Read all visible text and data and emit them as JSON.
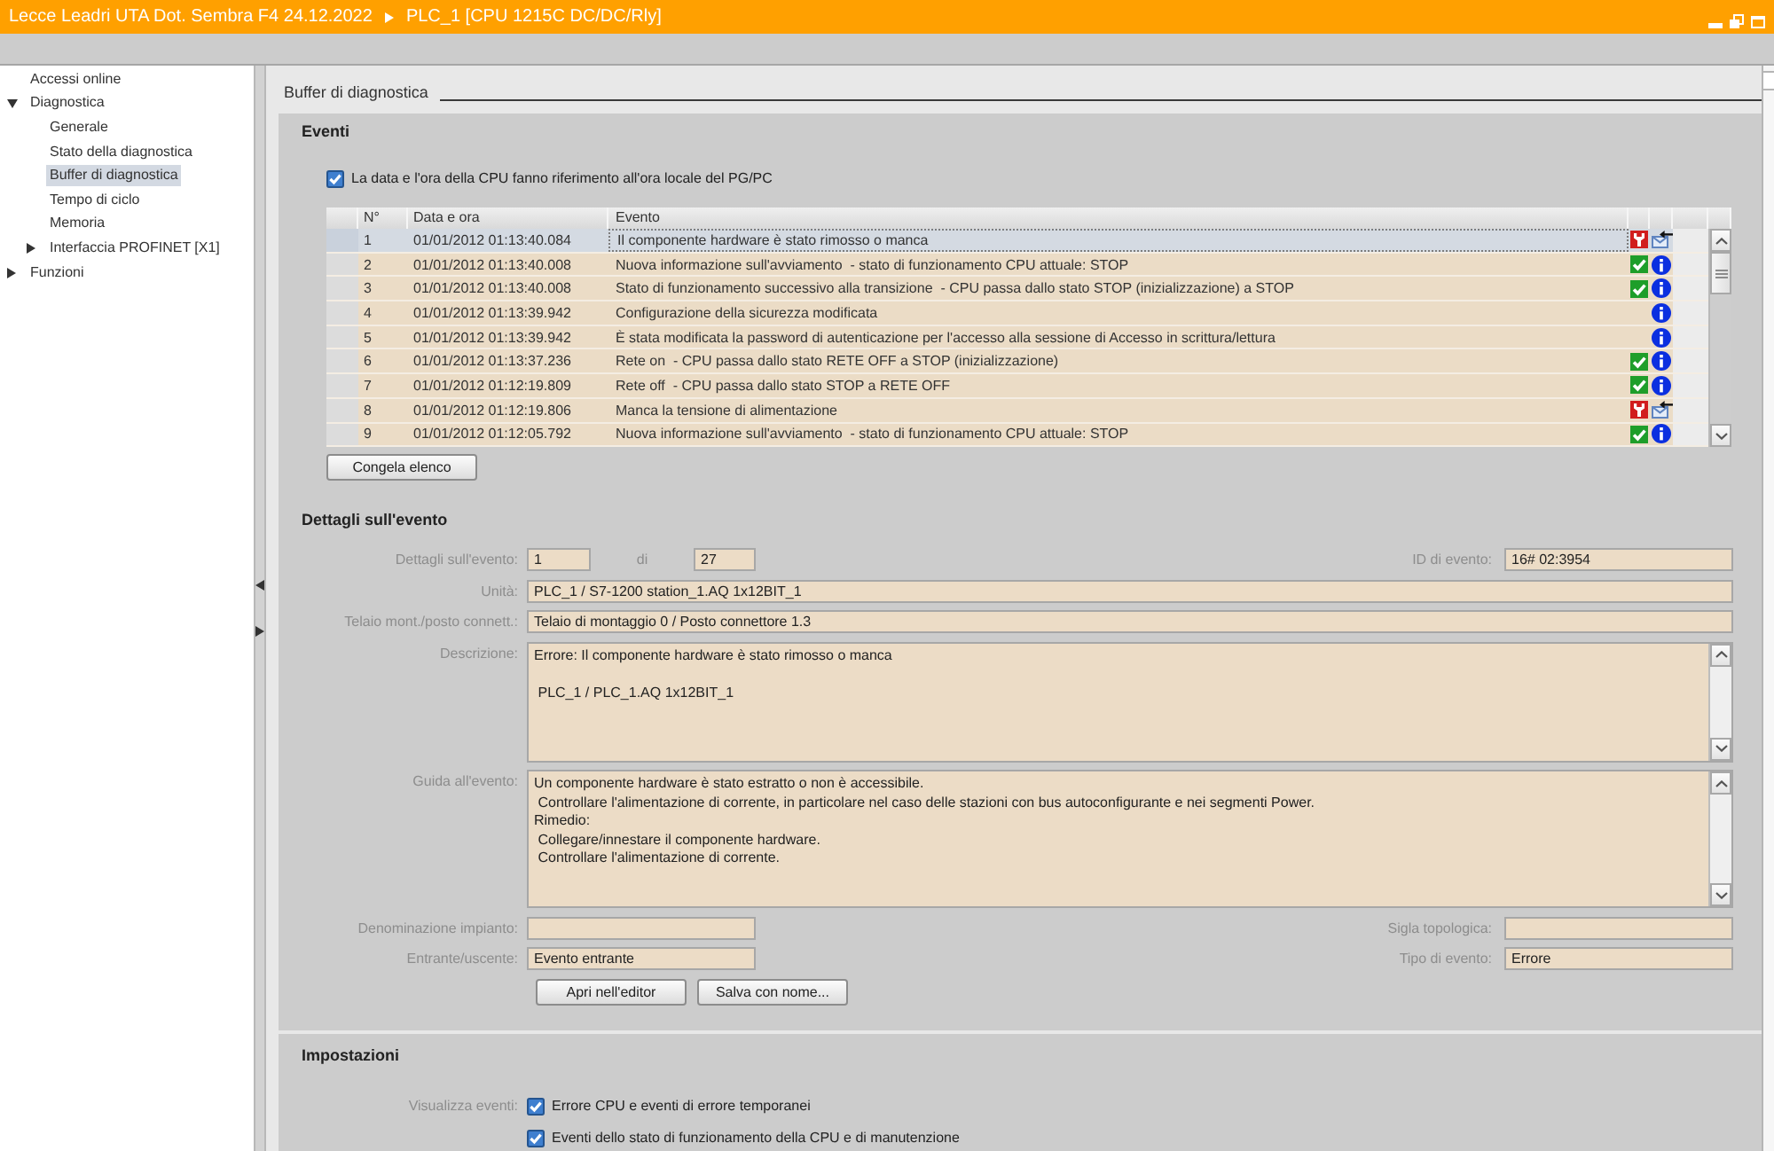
{
  "window": {
    "breadcrumb": [
      "Lecce Leadri UTA Dot. Sembra F4 24.12.2022",
      "PLC_1 [CPU 1215C DC/DC/Rly]"
    ]
  },
  "sidebar": {
    "items": [
      {
        "label": "Accessi online",
        "selected": false
      },
      {
        "label": "Diagnostica",
        "selected": false,
        "expanded": true,
        "children": [
          {
            "label": "Generale",
            "selected": false
          },
          {
            "label": "Stato della diagnostica",
            "selected": false
          },
          {
            "label": "Buffer di diagnostica",
            "selected": true
          },
          {
            "label": "Tempo di ciclo",
            "selected": false
          },
          {
            "label": "Memoria",
            "selected": false
          },
          {
            "label": "Interfaccia PROFINET [X1]",
            "selected": false,
            "expanded": false
          }
        ]
      },
      {
        "label": "Funzioni",
        "selected": false,
        "expanded": false
      }
    ]
  },
  "page": {
    "title": "Buffer di diagnostica"
  },
  "events": {
    "title": "Eventi",
    "local_time": {
      "label": "La data e l'ora della CPU fanno riferimento all'ora locale del PG/PC",
      "checked": true
    },
    "table": {
      "columns": [
        "N°",
        "Data e ora",
        "Evento"
      ],
      "rows": [
        {
          "number": "1",
          "datetime": "01/01/2012 01:13:40.084",
          "event": "Il componente hardware è stato rimosso o manca",
          "kind": "fault",
          "selected": true
        },
        {
          "number": "2",
          "datetime": "01/01/2012 01:13:40.008",
          "event": "Nuova informazione sull'avviamento  - stato di funzionamento CPU attuale: STOP",
          "kind": "ok",
          "selected": false
        },
        {
          "number": "3",
          "datetime": "01/01/2012 01:13:40.008",
          "event": "Stato di funzionamento successivo alla transizione  - CPU passa dallo stato STOP (inizializzazione) a STOP",
          "kind": "ok",
          "selected": false
        },
        {
          "number": "4",
          "datetime": "01/01/2012 01:13:39.942",
          "event": "Configurazione della sicurezza modificata",
          "kind": "info",
          "selected": false
        },
        {
          "number": "5",
          "datetime": "01/01/2012 01:13:39.942",
          "event": "È stata modificata la password di autenticazione per l'accesso alla sessione di Accesso in scrittura/lettura",
          "kind": "info",
          "selected": false
        },
        {
          "number": "6",
          "datetime": "01/01/2012 01:13:37.236",
          "event": "Rete on  - CPU passa dallo stato RETE OFF a STOP (inizializzazione)",
          "kind": "ok",
          "selected": false
        },
        {
          "number": "7",
          "datetime": "01/01/2012 01:12:19.809",
          "event": "Rete off  - CPU passa dallo stato STOP a RETE OFF",
          "kind": "ok",
          "selected": false
        },
        {
          "number": "8",
          "datetime": "01/01/2012 01:12:19.806",
          "event": "Manca la tensione di alimentazione",
          "kind": "fault",
          "selected": false
        },
        {
          "number": "9",
          "datetime": "01/01/2012 01:12:05.792",
          "event": "Nuova informazione sull'avviamento  - stato di funzionamento CPU attuale: STOP",
          "kind": "ok",
          "selected": false
        }
      ]
    },
    "freeze_button": "Congela elenco"
  },
  "details": {
    "title": "Dettagli sull'evento",
    "event_number": {
      "label": "Dettagli sull'evento:",
      "value": "1",
      "separator": "di",
      "total": "27"
    },
    "event_id": {
      "label": "ID di evento:",
      "value": "16# 02:3954"
    },
    "module": {
      "label": "Unità:",
      "value": "PLC_1 / S7-1200 station_1.AQ 1x12BIT_1"
    },
    "rack_slot": {
      "label": "Telaio mont./posto connett.:",
      "value": "Telaio di montaggio 0 / Posto connettore 1.3"
    },
    "description": {
      "label": "Descrizione:",
      "value": "Errore: Il componente hardware è stato rimosso o manca\n\n PLC_1 / PLC_1.AQ 1x12BIT_1"
    },
    "help": {
      "label": "Guida all'evento:",
      "value": "Un componente hardware è stato estratto o non è accessibile.\n Controllare l'alimentazione di corrente, in particolare nel caso delle stazioni con bus autoconfigurante e nei segmenti Power.\nRimedio:\n Collegare/innestare il componente hardware.\n Controllare l'alimentazione di corrente."
    },
    "plant_designation": {
      "label": "Denominazione impianto:"
    },
    "location_id": {
      "label": "Sigla topologica:"
    },
    "direction": {
      "label": "Entrante/uscente:",
      "value": "Evento entrante"
    },
    "event_type": {
      "label": "Tipo di evento:",
      "value": "Errore"
    },
    "buttons": [
      "Apri nell'editor",
      "Salva con nome..."
    ]
  },
  "settings": {
    "title": "Impostazioni",
    "label": "Visualizza eventi:",
    "options": [
      {
        "label": "Errore CPU e eventi di errore temporanei",
        "checked": true
      },
      {
        "label": "Eventi dello stato di funzionamento della CPU e di manutenzione",
        "checked": true
      }
    ]
  }
}
